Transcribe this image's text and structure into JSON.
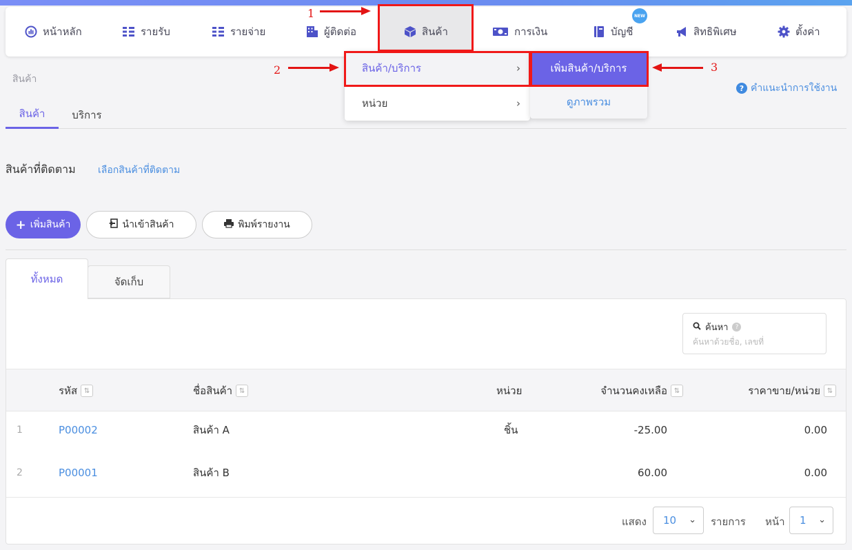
{
  "nav": {
    "items": [
      {
        "label": "หน้าหลัก",
        "icon": "dashboard-icon"
      },
      {
        "label": "รายรับ",
        "icon": "income-icon"
      },
      {
        "label": "รายจ่าย",
        "icon": "expense-icon"
      },
      {
        "label": "ผู้ติดต่อ",
        "icon": "contacts-icon"
      },
      {
        "label": "สินค้า",
        "icon": "box-icon"
      },
      {
        "label": "การเงิน",
        "icon": "money-icon"
      },
      {
        "label": "บัญชี",
        "icon": "ledger-icon",
        "badge": "NEW"
      },
      {
        "label": "สิทธิพิเศษ",
        "icon": "megaphone-icon"
      },
      {
        "label": "ตั้งค่า",
        "icon": "gear-icon"
      }
    ]
  },
  "dropdown": {
    "items": [
      {
        "label": "สินค้า/บริการ",
        "chevron": "›"
      },
      {
        "label": "หน่วย",
        "chevron": "›"
      }
    ],
    "submenu": {
      "add_label": "เพิ่มสินค้า/บริการ",
      "overview_label": "ดูภาพรวม"
    }
  },
  "annotations": {
    "n1": "1",
    "n2": "2",
    "n3": "3"
  },
  "breadcrumb": "สินค้า",
  "help_link": "คำแนะนำการใช้งาน",
  "page_tabs": [
    "สินค้า",
    "บริการ"
  ],
  "followed": {
    "title": "สินค้าที่ติดตาม",
    "link": "เลือกสินค้าที่ติดตาม"
  },
  "actions": {
    "add": "เพิ่มสินค้า",
    "import": "นำเข้าสินค้า",
    "print": "พิมพ์รายงาน"
  },
  "filter_tabs": [
    "ทั้งหมด",
    "จัดเก็บ"
  ],
  "search": {
    "label": "ค้นหา",
    "placeholder": "ค้นหาด้วยชื่อ, เลขที่"
  },
  "table": {
    "columns": {
      "code": "รหัส",
      "name": "ชื่อสินค้า",
      "unit": "หน่วย",
      "stock": "จำนวนคงเหลือ",
      "price": "ราคาขาย/หน่วย"
    },
    "rows": [
      {
        "index": "1",
        "code": "P00002",
        "name": "สินค้า A",
        "unit": "ชิ้น",
        "stock": "-25.00",
        "price": "0.00"
      },
      {
        "index": "2",
        "code": "P00001",
        "name": "สินค้า B",
        "unit": "",
        "stock": "60.00",
        "price": "0.00"
      }
    ]
  },
  "pagination": {
    "show_label": "แสดง",
    "page_size": "10",
    "items_label": "รายการ",
    "page_label": "หน้า",
    "page": "1"
  },
  "colors": {
    "accent": "#6b63e6",
    "link": "#4a8ee0",
    "annotation": "#e31414"
  }
}
